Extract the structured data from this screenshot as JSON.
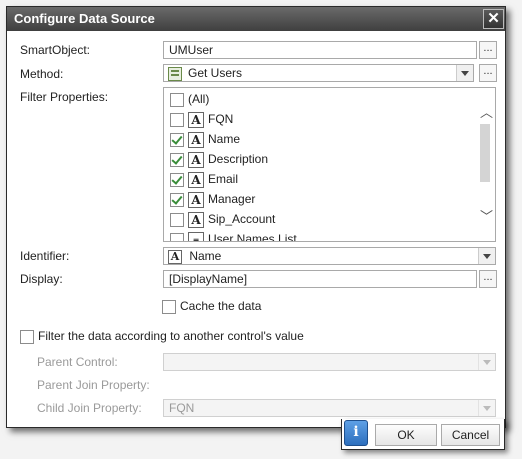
{
  "dialog": {
    "title": "Configure Data Source",
    "close_glyph": "✕"
  },
  "smartobject": {
    "label": "SmartObject:",
    "value": "UMUser",
    "browse": "..."
  },
  "method": {
    "label": "Method:",
    "value": "Get Users",
    "browse": "..."
  },
  "filter_properties": {
    "label": "Filter Properties:",
    "items": [
      {
        "label": "(All)",
        "checked": false,
        "icon": ""
      },
      {
        "label": "FQN",
        "checked": false,
        "icon": "A"
      },
      {
        "label": "Name",
        "checked": true,
        "icon": "A"
      },
      {
        "label": "Description",
        "checked": true,
        "icon": "A"
      },
      {
        "label": "Email",
        "checked": true,
        "icon": "A"
      },
      {
        "label": "Manager",
        "checked": true,
        "icon": "A"
      },
      {
        "label": "Sip_Account",
        "checked": false,
        "icon": "A"
      },
      {
        "label": "User Names List",
        "checked": false,
        "icon": "list"
      }
    ]
  },
  "identifier": {
    "label": "Identifier:",
    "value": "Name",
    "icon": "A"
  },
  "display": {
    "label": "Display:",
    "value": "[DisplayName]",
    "browse": "..."
  },
  "cache": {
    "label": "Cache the data",
    "checked": false
  },
  "filter_by_control": {
    "label": "Filter the data according to another control's value",
    "checked": false
  },
  "parent_control": {
    "label": "Parent Control:",
    "value": ""
  },
  "parent_join": {
    "label": "Parent Join Property:"
  },
  "child_join": {
    "label": "Child Join Property:",
    "value": "FQN"
  },
  "footer": {
    "info": "i",
    "ok": "OK",
    "cancel": "Cancel"
  }
}
